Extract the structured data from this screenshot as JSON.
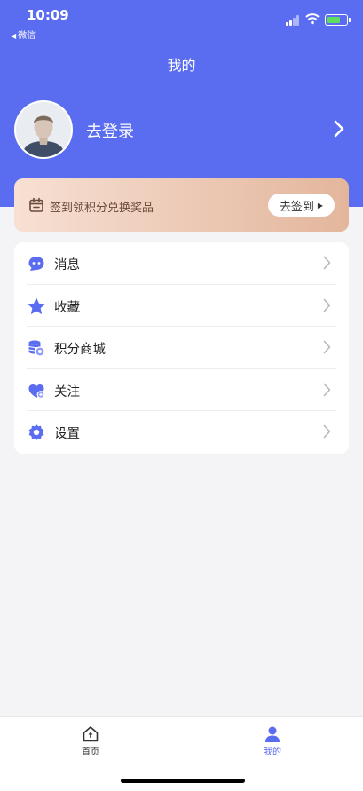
{
  "status_bar": {
    "time": "10:09",
    "back_app": "微信"
  },
  "header": {
    "title": "我的"
  },
  "profile": {
    "login_label": "去登录"
  },
  "signin": {
    "text": "签到领积分兑换奖品",
    "button_label": "去签到"
  },
  "menu": {
    "items": [
      {
        "label": "消息",
        "icon": "message-icon"
      },
      {
        "label": "收藏",
        "icon": "star-icon"
      },
      {
        "label": "积分商城",
        "icon": "points-mall-icon"
      },
      {
        "label": "关注",
        "icon": "heart-icon"
      },
      {
        "label": "设置",
        "icon": "settings-icon"
      }
    ]
  },
  "tabbar": {
    "items": [
      {
        "label": "首页",
        "icon": "home-icon",
        "active": false
      },
      {
        "label": "我的",
        "icon": "user-icon",
        "active": true
      }
    ]
  },
  "colors": {
    "accent": "#5a6cf0",
    "banner_start": "#f7e0d3",
    "banner_end": "#e3b69c"
  }
}
